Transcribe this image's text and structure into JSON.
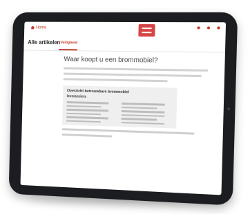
{
  "header": {
    "home_link": "Home",
    "link_2": "",
    "link_3": "",
    "utility": [
      "",
      "",
      ""
    ]
  },
  "nav": {
    "all_articles": "Alle artikelen",
    "tabs": [
      "Veiligheid",
      "",
      "",
      "",
      "",
      "",
      ""
    ],
    "active_index": 0
  },
  "article": {
    "title": "Waar koopt u een brommobiel?",
    "paragraph_lines": [
      "",
      "",
      ""
    ],
    "list_title": "Overzicht betrouwbare brommobiel",
    "list_subtitle": "leveranciers",
    "list_items_left": [
      "",
      "",
      "",
      "",
      "",
      ""
    ],
    "list_items_right": [
      "",
      "",
      "",
      "",
      "",
      ""
    ],
    "closing_lines": [
      "",
      ""
    ]
  },
  "colors": {
    "accent": "#c33b2e",
    "logo": "#d64545",
    "bezel": "#1c1d20",
    "infobox_bg": "#efefef"
  }
}
